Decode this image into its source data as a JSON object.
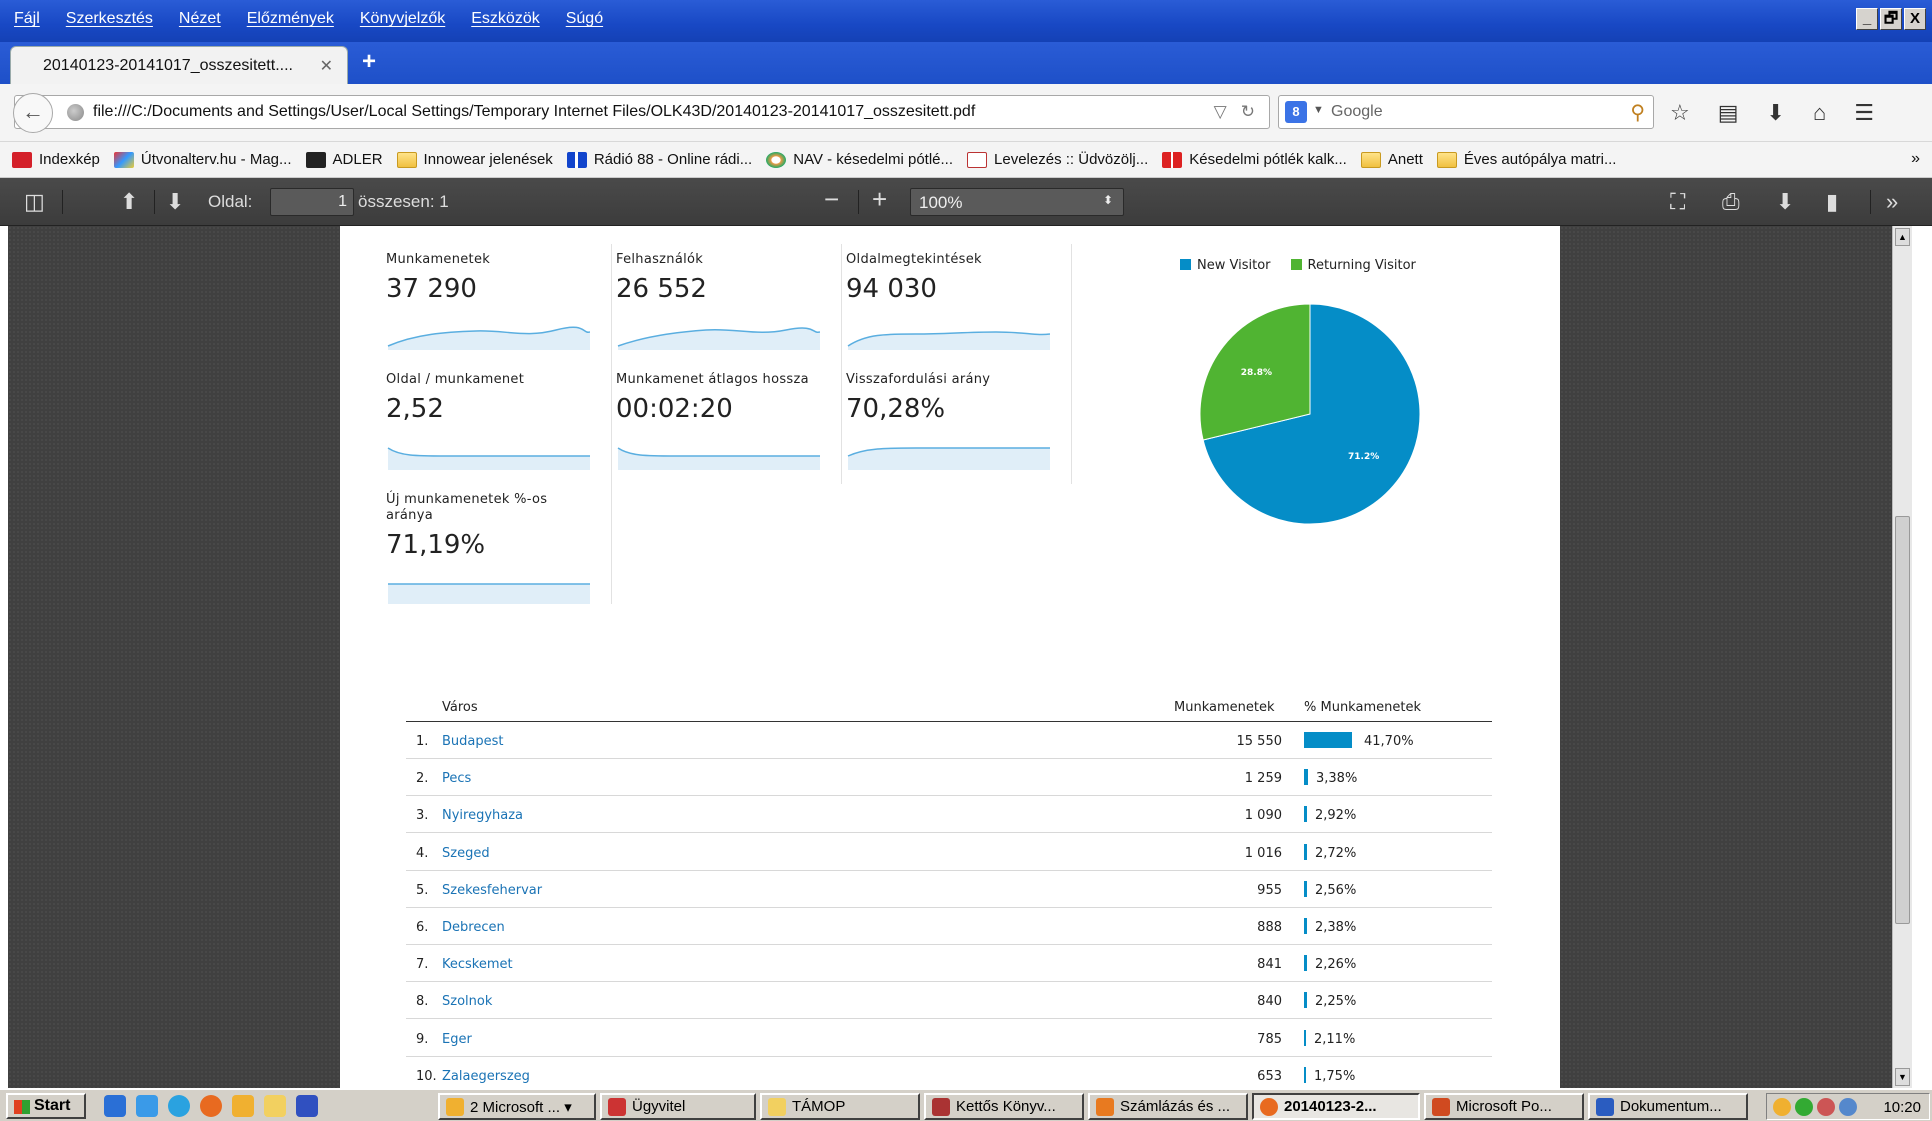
{
  "menu": [
    "Fájl",
    "Szerkesztés",
    "Nézet",
    "Előzmények",
    "Könyvjelzők",
    "Eszközök",
    "Súgó"
  ],
  "window_buttons": [
    "_",
    "🗗",
    "X"
  ],
  "tab": {
    "title": "20140123-20141017_osszesitett....",
    "close": "✕",
    "new_tab": "+"
  },
  "nav": {
    "url": "file:///C:/Documents and Settings/User/Local Settings/Temporary Internet Files/OLK43D/20140123-20141017_osszesitett.pdf",
    "search_engine": "Google",
    "search_placeholder": "Google"
  },
  "bookmarks": [
    {
      "label": "Indexkép",
      "icon": "red-play-icon"
    },
    {
      "label": "Útvonalterv.hu - Mag...",
      "icon": "route-icon"
    },
    {
      "label": "ADLER",
      "icon": "adler-icon"
    },
    {
      "label": "Innowear jelenések",
      "icon": "folder-icon"
    },
    {
      "label": "Rádió 88 - Online rádi...",
      "icon": "radio-icon"
    },
    {
      "label": "NAV - késedelmi pótlé...",
      "icon": "nav-icon"
    },
    {
      "label": "Levelezés :: Üdvözölj...",
      "icon": "mail-icon"
    },
    {
      "label": "Késedelmi pótlék kalk...",
      "icon": "calc-icon"
    },
    {
      "label": "Anett",
      "icon": "folder-icon"
    },
    {
      "label": "Éves autópálya matri...",
      "icon": "folder-icon"
    }
  ],
  "bookmarks_more": "»",
  "pdf_toolbar": {
    "page_label": "Oldal:",
    "page_value": "1",
    "page_total": "összesen: 1",
    "zoom": "100%"
  },
  "metrics": [
    {
      "label": "Munkamenetek",
      "value": "37 290"
    },
    {
      "label": "Felhasználók",
      "value": "26 552"
    },
    {
      "label": "Oldalmegtekintések",
      "value": "94 030"
    },
    {
      "label": "Oldal / munkamenet",
      "value": "2,52"
    },
    {
      "label": "Munkamenet átlagos hossza",
      "value": "00:02:20"
    },
    {
      "label": "Visszafordulási arány",
      "value": "70,28%"
    },
    {
      "label": "Új munkamenetek %-os aránya",
      "value": "71,19%"
    }
  ],
  "chart_data": {
    "type": "pie",
    "series": [
      {
        "name": "New Visitor",
        "value": 71.2,
        "label": "71.2%",
        "color": "#058dc7"
      },
      {
        "name": "Returning Visitor",
        "value": 28.8,
        "label": "28.8%",
        "color": "#50b432"
      }
    ],
    "legend": "top"
  },
  "table": {
    "headers": [
      "Város",
      "Munkamenetek",
      "% Munkamenetek"
    ],
    "rows": [
      {
        "rank": "1.",
        "city": "Budapest",
        "sessions": "15 550",
        "pct": "41,70%",
        "pct_value": 41.7
      },
      {
        "rank": "2.",
        "city": "Pecs",
        "sessions": "1 259",
        "pct": "3,38%",
        "pct_value": 3.38
      },
      {
        "rank": "3.",
        "city": "Nyiregyhaza",
        "sessions": "1 090",
        "pct": "2,92%",
        "pct_value": 2.92
      },
      {
        "rank": "4.",
        "city": "Szeged",
        "sessions": "1 016",
        "pct": "2,72%",
        "pct_value": 2.72
      },
      {
        "rank": "5.",
        "city": "Szekesfehervar",
        "sessions": "955",
        "pct": "2,56%",
        "pct_value": 2.56
      },
      {
        "rank": "6.",
        "city": "Debrecen",
        "sessions": "888",
        "pct": "2,38%",
        "pct_value": 2.38
      },
      {
        "rank": "7.",
        "city": "Kecskemet",
        "sessions": "841",
        "pct": "2,26%",
        "pct_value": 2.26
      },
      {
        "rank": "8.",
        "city": "Szolnok",
        "sessions": "840",
        "pct": "2,25%",
        "pct_value": 2.25
      },
      {
        "rank": "9.",
        "city": "Eger",
        "sessions": "785",
        "pct": "2,11%",
        "pct_value": 2.11
      },
      {
        "rank": "10.",
        "city": "Zalaegerszeg",
        "sessions": "653",
        "pct": "1,75%",
        "pct_value": 1.75
      }
    ],
    "bar_color": "#058dc7"
  },
  "taskbar": {
    "start": "Start",
    "tasks": [
      {
        "label": "2 Microsoft ...",
        "icon": "office-icon"
      },
      {
        "label": "Ügyvitel",
        "icon": "app-icon"
      },
      {
        "label": "TÁMOP",
        "icon": "folder-icon"
      },
      {
        "label": "Kettős Könyv...",
        "icon": "app-icon"
      },
      {
        "label": "Számlázás és ...",
        "icon": "app-icon"
      },
      {
        "label": "20140123-2...",
        "icon": "firefox-icon",
        "active": true
      },
      {
        "label": "Microsoft Po...",
        "icon": "powerpoint-icon"
      },
      {
        "label": "Dokumentum...",
        "icon": "word-icon"
      }
    ],
    "clock": "10:20"
  }
}
